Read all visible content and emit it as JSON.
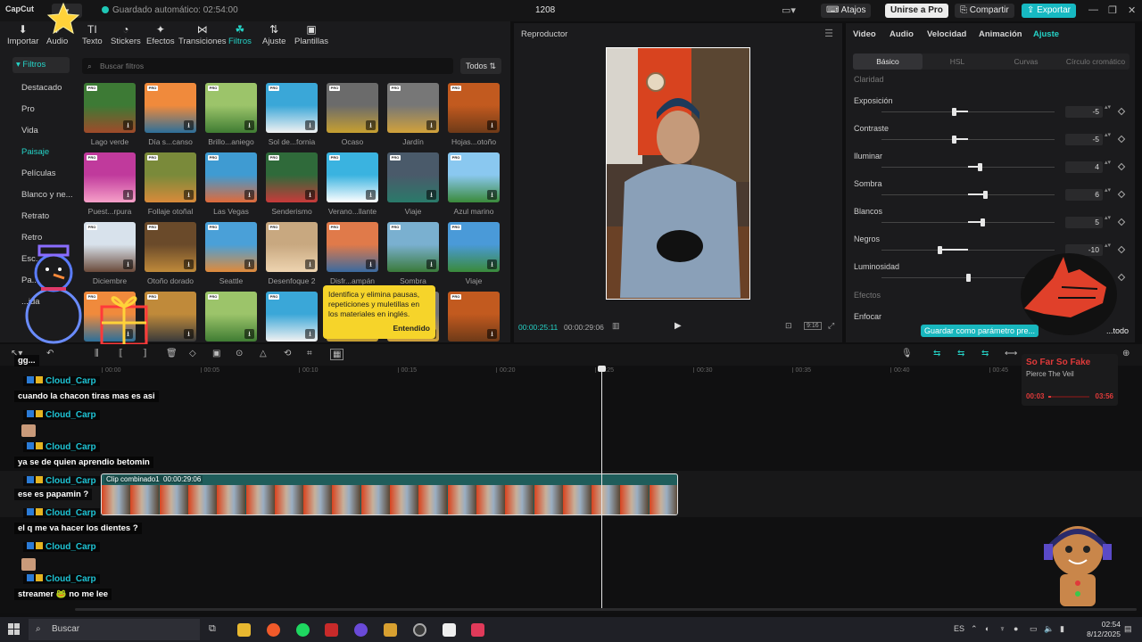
{
  "app": {
    "logo": "CapCut",
    "autosave": "Guardado automático: 02:54:00",
    "project": "1208",
    "shortcuts": "Atajos",
    "join_pro": "Unirse a Pro",
    "share": "Compartir",
    "export": "Exportar"
  },
  "toolbar": {
    "items": [
      {
        "label": "Importar",
        "icon": "⬇"
      },
      {
        "label": "Audio",
        "icon": "♪"
      },
      {
        "label": "Texto",
        "icon": "TI"
      },
      {
        "label": "Stickers",
        "icon": "◔"
      },
      {
        "label": "Efectos",
        "icon": "✦"
      },
      {
        "label": "Transiciones",
        "icon": "⋈"
      },
      {
        "label": "Filtros",
        "icon": "☘"
      },
      {
        "label": "Ajuste",
        "icon": "⇅"
      },
      {
        "label": "Plantillas",
        "icon": "▣"
      }
    ]
  },
  "filters": {
    "header": "Filtros",
    "search_placeholder": "Buscar filtros",
    "sort": "Todos",
    "categories": [
      "Destacado",
      "Pro",
      "Vida",
      "Paisaje",
      "Películas",
      "Blanco y ne...",
      "Retrato",
      "Retro",
      "Esc...",
      "Pa...",
      "...ida"
    ],
    "items": [
      {
        "label": "Lago verde",
        "c1": "#3d7a35",
        "c2": "#a04a2a"
      },
      {
        "label": "Día s...canso",
        "c1": "#f08a3c",
        "c2": "#2c6f9a"
      },
      {
        "label": "Brillo...aniego",
        "c1": "#9cc46a",
        "c2": "#3f7c33"
      },
      {
        "label": "Sol de...fornia",
        "c1": "#3aa7d8",
        "c2": "#f2f2f2"
      },
      {
        "label": "Ocaso",
        "c1": "#6b6b6b",
        "c2": "#c8a030"
      },
      {
        "label": "Jardín",
        "c1": "#777777",
        "c2": "#d2a23a"
      },
      {
        "label": "Hojas...otoño",
        "c1": "#c25a1f",
        "c2": "#6e3a18"
      },
      {
        "label": "Puest...rpura",
        "c1": "#c03a9c",
        "c2": "#f6a0c8"
      },
      {
        "label": "Follaje otoñal",
        "c1": "#7a8a3a",
        "c2": "#d98a3a"
      },
      {
        "label": "Las Vegas",
        "c1": "#3f9bd2",
        "c2": "#e06a3a"
      },
      {
        "label": "Senderismo",
        "c1": "#2f6a3a",
        "c2": "#c83a3a"
      },
      {
        "label": "Verano...llante",
        "c1": "#3ab3e0",
        "c2": "#ffffff"
      },
      {
        "label": "Viaje",
        "c1": "#4a5a6a",
        "c2": "#2a7a6a"
      },
      {
        "label": "Azul marino",
        "c1": "#8ac8f0",
        "c2": "#3a8a3a"
      },
      {
        "label": "Diciembre",
        "c1": "#d8e2ec",
        "c2": "#6a4a3a"
      },
      {
        "label": "Otoño dorado",
        "c1": "#6a4a2a",
        "c2": "#c08a3a"
      },
      {
        "label": "Seattle",
        "c1": "#4aa0d8",
        "c2": "#e08a3a"
      },
      {
        "label": "Desenfoque 2",
        "c1": "#c8a880",
        "c2": "#eed4b0"
      },
      {
        "label": "Disfr...ampán",
        "c1": "#e07a4a",
        "c2": "#3a6aa0"
      },
      {
        "label": "Sombra",
        "c1": "#7ab0d0",
        "c2": "#3a7a3a"
      },
      {
        "label": "Viaje",
        "c1": "#4a9ad8",
        "c2": "#3a8a3a"
      },
      {
        "label": "",
        "c1": "#f08a3c",
        "c2": "#2c6f9a"
      },
      {
        "label": "",
        "c1": "#c08a3a",
        "c2": "#3a3a3a"
      },
      {
        "label": "",
        "c1": "#9cc46a",
        "c2": "#3f7c33"
      },
      {
        "label": "",
        "c1": "#3aa7d8",
        "c2": "#f2f2f2"
      },
      {
        "label": "",
        "c1": "#6b6b6b",
        "c2": "#c8a030"
      },
      {
        "label": "",
        "c1": "#777777",
        "c2": "#d2a23a"
      },
      {
        "label": "",
        "c1": "#c25a1f",
        "c2": "#6e3a18"
      }
    ]
  },
  "tooltip": {
    "text": "Identifica y elimina pausas, repeticiones y muletillas en los materiales en inglés.",
    "ok": "Entendido"
  },
  "player": {
    "title": "Reproductor",
    "current": "00:00:25:11",
    "total": "00:00:29:06",
    "ratio": "9:16"
  },
  "adjust": {
    "tabs": [
      "Video",
      "Audio",
      "Velocidad",
      "Animación",
      "Ajuste"
    ],
    "subtabs": [
      "Básico",
      "HSL",
      "Curvas",
      "Círculo cromático"
    ],
    "section_top": "Claridad",
    "params": [
      {
        "label": "Exposición",
        "value": "-5",
        "pos": -5
      },
      {
        "label": "Contraste",
        "value": "-5",
        "pos": -5
      },
      {
        "label": "Iluminar",
        "value": "4",
        "pos": 4
      },
      {
        "label": "Sombra",
        "value": "6",
        "pos": 6
      },
      {
        "label": "Blancos",
        "value": "5",
        "pos": 5
      },
      {
        "label": "Negros",
        "value": "-10",
        "pos": -10
      },
      {
        "label": "Luminosidad",
        "value": "",
        "pos": 0
      }
    ],
    "section_effects": "Efectos",
    "section_focus": "Enfocar",
    "save_preset": "Guardar como parámetro pre...",
    "apply_all": "...todo"
  },
  "timeline": {
    "ruler": [
      "00:00",
      "00:05",
      "00:10",
      "00:15",
      "00:20",
      "00:25",
      "00:30",
      "00:35",
      "00:40",
      "00:45"
    ],
    "clip_title": "Clip combinado1",
    "clip_duration": "00:00:29:06"
  },
  "chat": [
    {
      "type": "msg",
      "text": "gg..."
    },
    {
      "type": "user",
      "text": "Cloud_Carp"
    },
    {
      "type": "msg",
      "text": "cuando la chacon tiras mas es asi"
    },
    {
      "type": "user",
      "text": "Cloud_Carp"
    },
    {
      "type": "emote"
    },
    {
      "type": "user",
      "text": "Cloud_Carp"
    },
    {
      "type": "msg",
      "text": "ya se de quien aprendio betomin"
    },
    {
      "type": "user",
      "text": "Cloud_Carp"
    },
    {
      "type": "msg",
      "text": "ese es papamin ?"
    },
    {
      "type": "user",
      "text": "Cloud_Carp"
    },
    {
      "type": "msg",
      "text": "el q me va hacer los dientes ?"
    },
    {
      "type": "user",
      "text": "Cloud_Carp"
    },
    {
      "type": "emote"
    },
    {
      "type": "user",
      "text": "Cloud_Carp"
    },
    {
      "type": "msg",
      "text": "streamer 🐸 no me lee"
    }
  ],
  "music": {
    "title": "So Far So Fake",
    "artist": "Pierce The Veil",
    "elapsed": "00:03",
    "duration": "03:56",
    "progress": 0.06
  },
  "taskbar": {
    "search": "Buscar",
    "lang": "ES",
    "time": "02:54",
    "date": "8/12/2025"
  },
  "colors": {
    "accent": "#25d3c7",
    "export": "#17b9c2",
    "music": "#e03a3a"
  }
}
